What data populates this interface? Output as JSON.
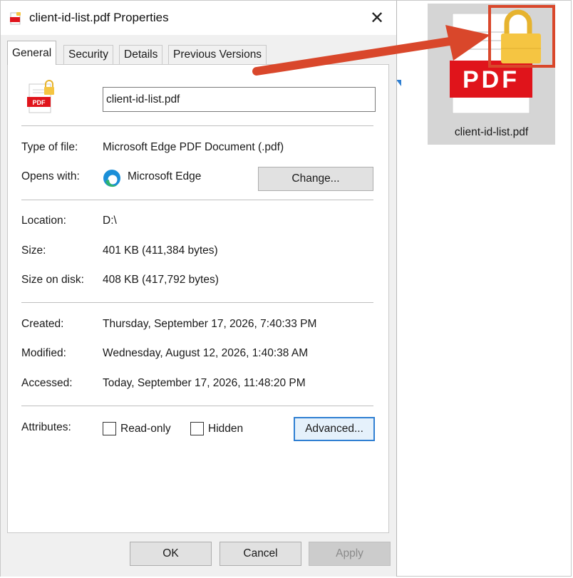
{
  "dialog": {
    "title": "client-id-list.pdf Properties",
    "close_symbol": "✕",
    "tabs": [
      {
        "label": "General",
        "active": true
      },
      {
        "label": "Security",
        "active": false
      },
      {
        "label": "Details",
        "active": false
      },
      {
        "label": "Previous Versions",
        "active": false
      }
    ],
    "file_icon": "pdf-locked-icon",
    "file_icon_text": "PDF",
    "file_name": "client-id-list.pdf",
    "type_of_file": {
      "label": "Type of file:",
      "value": "Microsoft Edge PDF Document (.pdf)"
    },
    "opens_with": {
      "label": "Opens with:",
      "value": "Microsoft Edge",
      "icon": "edge-icon",
      "button": "Change..."
    },
    "location": {
      "label": "Location:",
      "value": "D:\\"
    },
    "size": {
      "label": "Size:",
      "value": "401 KB (411,384 bytes)"
    },
    "size_on_disk": {
      "label": "Size on disk:",
      "value": "408 KB (417,792 bytes)"
    },
    "created": {
      "label": "Created:",
      "value": "Thursday, September 17, 2026, 7:40:33 PM"
    },
    "modified": {
      "label": "Modified:",
      "value": "Wednesday, August 12, 2026, 1:40:38 AM"
    },
    "accessed": {
      "label": "Accessed:",
      "value": "Today, September 17, 2026, 11:48:20 PM"
    },
    "attributes": {
      "label": "Attributes:",
      "read_only": {
        "label": "Read-only",
        "checked": false
      },
      "hidden": {
        "label": "Hidden",
        "checked": false
      },
      "advanced_button": "Advanced..."
    },
    "buttons": {
      "ok": "OK",
      "cancel": "Cancel",
      "apply": "Apply"
    }
  },
  "desktop_file": {
    "label": "client-id-list.pdf",
    "icon_text": "PDF",
    "icon": "pdf-file-lock-icon"
  },
  "colors": {
    "pdf_red": "#e0141b",
    "lock_gold": "#f5c542",
    "highlight_red": "#d9472b",
    "focus_blue": "#2f7fd2"
  }
}
